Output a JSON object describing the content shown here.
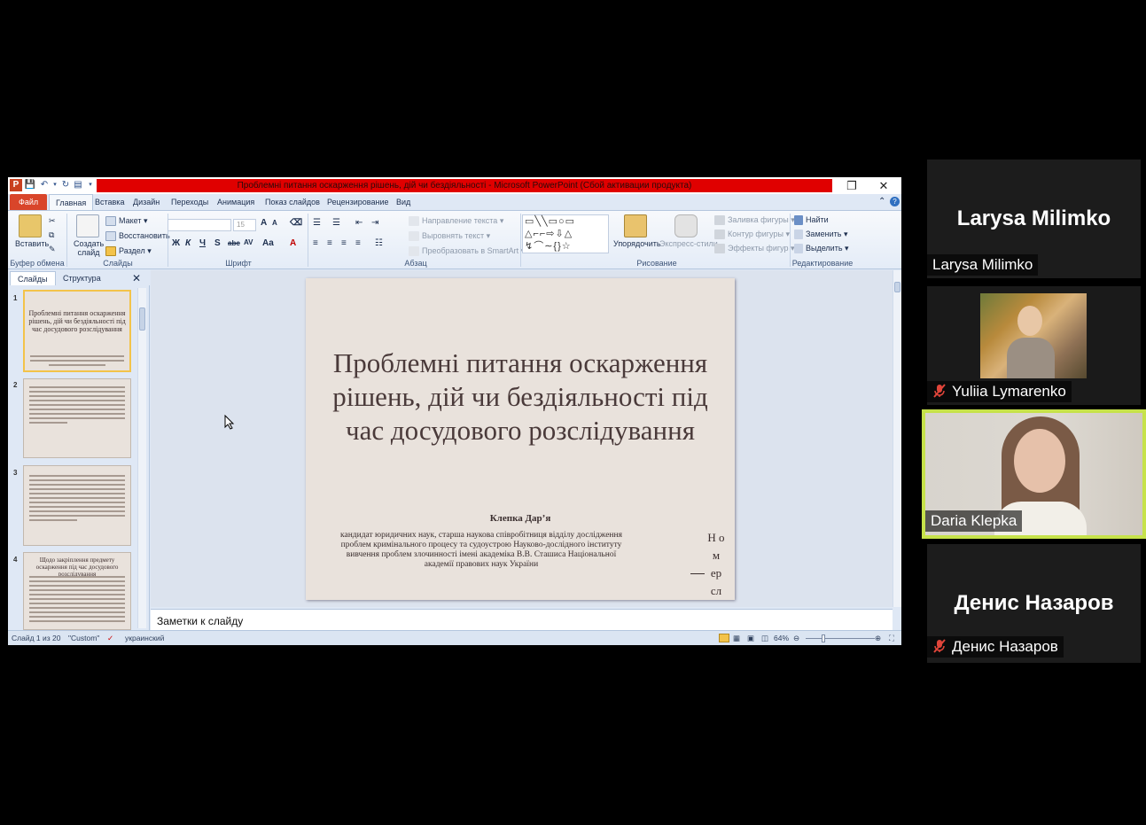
{
  "window": {
    "title": "Проблемні питання оскарження рішень, дій чи бездіяльності  -  Microsoft PowerPoint (Сбой активации продукта)"
  },
  "tabs": [
    "Файл",
    "Главная",
    "Вставка",
    "Дизайн",
    "Переходы",
    "Анимация",
    "Показ слайдов",
    "Рецензирование",
    "Вид"
  ],
  "ribbon": {
    "clipboard": {
      "paste": "Вставить",
      "label": "Буфер обмена"
    },
    "slides": {
      "create": "Создать слайд",
      "layout": "Макет",
      "reset": "Восстановить",
      "section": "Раздел",
      "label": "Слайды"
    },
    "font": {
      "size": "15",
      "bold": "Ж",
      "italic": "К",
      "underline": "Ч",
      "strike": "S",
      "abc": "abc",
      "spacing": "AV",
      "case": "Aa",
      "grow": "A",
      "label": "Шрифт"
    },
    "paragraph": {
      "direction": "Направление текста",
      "align": "Выровнять текст",
      "smartart": "Преобразовать в SmartArt",
      "label": "Абзац"
    },
    "drawing": {
      "arrange": "Упорядочить",
      "quickstyles": "Экспресс-стили",
      "fill": "Заливка фигуры",
      "outline": "Контур фигуры",
      "effects": "Эффекты фигур",
      "label": "Рисование"
    },
    "editing": {
      "find": "Найти",
      "replace": "Заменить",
      "select": "Выделить",
      "label": "Редактирование"
    }
  },
  "panel": {
    "tab_slides": "Слайды",
    "tab_outline": "Структура"
  },
  "thumbnails": [
    {
      "num": "1",
      "title": "Проблемні питання оскарження рішень, дій чи бездіяльності під час досудового розслідування"
    },
    {
      "num": "2",
      "title": ""
    },
    {
      "num": "3",
      "title": ""
    },
    {
      "num": "4",
      "title": "Щодо закріплення предмету оскарження під час досудового розслідування"
    }
  ],
  "slide": {
    "title": "Проблемні питання оскарження рішень, дій чи бездіяльності під час досудового розслідування",
    "author": "Клепка Дар’я",
    "affiliation": "кандидат юридичних наук, старша наукова співробітниця відділу дослідження проблем кримінального процесу та судоустрою Науково-дослідного інституту вивчення проблем злочинності імені академіка В.В. Сташиса Національної академії правових наук України",
    "side_num": "Н о м ер сл"
  },
  "notes": {
    "placeholder": "Заметки к слайду"
  },
  "status": {
    "slide": "Слайд 1 из 20",
    "theme": "\"Custom\"",
    "language": "украинский",
    "zoom": "64%"
  },
  "participants": [
    {
      "name": "Larysa Milimko",
      "muted": false
    },
    {
      "name": "Yuliia Lymarenko",
      "muted": true
    },
    {
      "name": "Daria Klepka",
      "muted": false,
      "active": true
    },
    {
      "name": "Денис Назаров",
      "muted": true
    }
  ],
  "colors": {
    "file_tab": "#d9452a",
    "title_red": "#e00000",
    "slide_bg": "#e9e2dc",
    "speaker_border": "#c6e24a",
    "mic_muted": "#e0453a"
  }
}
